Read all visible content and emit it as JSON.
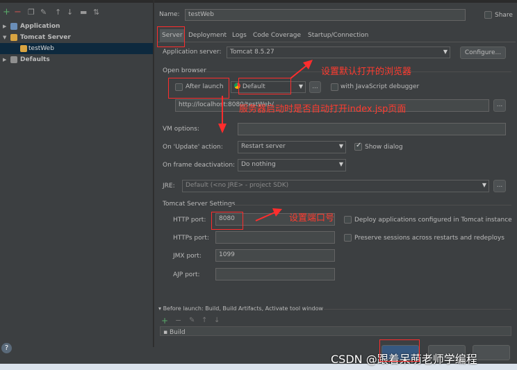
{
  "left_toolbar": {
    "icons": [
      "add-icon",
      "remove-icon",
      "copy-icon",
      "wrench-icon",
      "move-up-icon",
      "move-down-icon",
      "folder-icon",
      "sort-icon"
    ]
  },
  "tree": {
    "items": [
      {
        "label": "Application",
        "icon": "application-icon"
      },
      {
        "label": "Tomcat Server",
        "icon": "tomcat-icon"
      },
      {
        "label": "testWeb",
        "icon": "tomcat-icon"
      },
      {
        "label": "Defaults",
        "icon": "wrench-icon"
      }
    ]
  },
  "name_row": {
    "label": "Name:",
    "value": "testWeb",
    "share_label": "Share"
  },
  "tabs": [
    {
      "label": "Server"
    },
    {
      "label": "Deployment"
    },
    {
      "label": "Logs"
    },
    {
      "label": "Code Coverage"
    },
    {
      "label": "Startup/Connection"
    }
  ],
  "server": {
    "app_server_label": "Application server:",
    "app_server_value": "Tomcat 8.5.27",
    "configure_label": "Configure...",
    "open_browser_label": "Open browser",
    "after_launch_label": "After launch",
    "browser_value": "Default",
    "browse_btn": "...",
    "js_debugger_label": "with JavaScript debugger",
    "url_value": "http://localhost:8080/testWeb/",
    "url_btn": "...",
    "vm_options_label": "VM options:",
    "on_update_label": "On 'Update' action:",
    "on_update_value": "Restart server",
    "show_dialog_label": "Show dialog",
    "on_frame_label": "On frame deactivation:",
    "on_frame_value": "Do nothing",
    "jre_label": "JRE:",
    "jre_value": "Default (<no JRE> - project SDK)",
    "jre_btn": "...",
    "tomcat_settings_label": "Tomcat Server Settings",
    "http_port_label": "HTTP port:",
    "http_port_value": "8080",
    "https_port_label": "HTTPs port:",
    "jmx_port_label": "JMX port:",
    "jmx_port_value": "1099",
    "ajp_port_label": "AJP port:",
    "deploy_label": "Deploy applications configured in Tomcat instance",
    "preserve_label": "Preserve sessions across restarts and redeploys"
  },
  "before_launch": {
    "label": "Before launch: Build, Build Artifacts, Activate tool window",
    "build_item": "Build"
  },
  "annotations": {
    "browser": "设置默认打开的浏览器",
    "index": "服务器启动时是否自动打开index.jsp页面",
    "port": "设置端口号"
  },
  "help_icon": "?",
  "watermark": "CSDN @跟着呆萌老师学编程",
  "colors": {
    "annotation": "#ff3b2f",
    "selection": "#0d293e",
    "background": "#3c3f41"
  }
}
